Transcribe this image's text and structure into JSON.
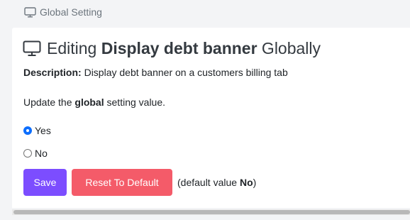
{
  "breadcrumb": {
    "icon": "monitor-icon",
    "label": "Global Setting"
  },
  "header": {
    "icon": "monitor-icon",
    "prefix": "Editing ",
    "setting_name": "Display debt banner",
    "suffix": " Globally"
  },
  "description": {
    "label": "Description:",
    "text": " Display debt banner on a customers billing tab"
  },
  "update_text": {
    "prefix": "Update the ",
    "bold": "global",
    "suffix": " setting value."
  },
  "options": [
    {
      "label": "Yes",
      "selected": true
    },
    {
      "label": "No",
      "selected": false
    }
  ],
  "buttons": {
    "save_label": "Save",
    "reset_label": "Reset To Default"
  },
  "default_note": {
    "prefix": "(default value ",
    "value": "No",
    "suffix": ")"
  },
  "colors": {
    "save": "#7c4dff",
    "reset": "#f45b69",
    "radio_checked": "#0d6efd"
  }
}
